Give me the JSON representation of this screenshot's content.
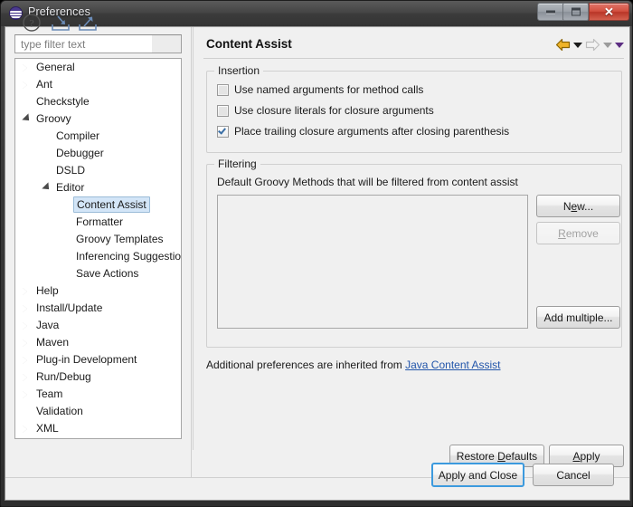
{
  "window": {
    "title": "Preferences",
    "icon": "eclipse-icon",
    "controls": {
      "minimize": "minimize-button",
      "maximize": "maximize-button",
      "close": "close-button"
    }
  },
  "sidebar": {
    "filter": {
      "placeholder": "type filter text",
      "value": ""
    },
    "items": [
      {
        "label": "General",
        "indent": 0,
        "state": "collapsed",
        "selected": false
      },
      {
        "label": "Ant",
        "indent": 0,
        "state": "collapsed",
        "selected": false
      },
      {
        "label": "Checkstyle",
        "indent": 0,
        "state": "leaf",
        "selected": false
      },
      {
        "label": "Groovy",
        "indent": 0,
        "state": "expanded",
        "selected": false
      },
      {
        "label": "Compiler",
        "indent": 1,
        "state": "leaf",
        "selected": false
      },
      {
        "label": "Debugger",
        "indent": 1,
        "state": "leaf",
        "selected": false
      },
      {
        "label": "DSLD",
        "indent": 1,
        "state": "leaf",
        "selected": false
      },
      {
        "label": "Editor",
        "indent": 1,
        "state": "expanded",
        "selected": false
      },
      {
        "label": "Content Assist",
        "indent": 2,
        "state": "leaf",
        "selected": true
      },
      {
        "label": "Formatter",
        "indent": 2,
        "state": "leaf",
        "selected": false
      },
      {
        "label": "Groovy Templates",
        "indent": 2,
        "state": "leaf",
        "selected": false
      },
      {
        "label": "Inferencing Suggestions",
        "indent": 2,
        "state": "leaf",
        "selected": false
      },
      {
        "label": "Save Actions",
        "indent": 2,
        "state": "leaf",
        "selected": false
      },
      {
        "label": "Help",
        "indent": 0,
        "state": "collapsed",
        "selected": false
      },
      {
        "label": "Install/Update",
        "indent": 0,
        "state": "collapsed",
        "selected": false
      },
      {
        "label": "Java",
        "indent": 0,
        "state": "collapsed",
        "selected": false
      },
      {
        "label": "Maven",
        "indent": 0,
        "state": "collapsed",
        "selected": false
      },
      {
        "label": "Plug-in Development",
        "indent": 0,
        "state": "collapsed",
        "selected": false
      },
      {
        "label": "Run/Debug",
        "indent": 0,
        "state": "collapsed",
        "selected": false
      },
      {
        "label": "Team",
        "indent": 0,
        "state": "collapsed",
        "selected": false
      },
      {
        "label": "Validation",
        "indent": 0,
        "state": "leaf",
        "selected": false
      },
      {
        "label": "XML",
        "indent": 0,
        "state": "collapsed",
        "selected": false
      }
    ]
  },
  "page": {
    "title": "Content Assist",
    "nav": {
      "back": "back-arrow-icon",
      "back_menu": "back-dropdown-icon",
      "forward": "forward-arrow-icon",
      "forward_menu": "forward-dropdown-icon",
      "view_menu": "view-menu-icon"
    },
    "insertion": {
      "legend": "Insertion",
      "options": [
        {
          "label": "Use named arguments for method calls",
          "checked": false
        },
        {
          "label": "Use closure literals for closure arguments",
          "checked": false
        },
        {
          "label": "Place trailing closure arguments after closing parenthesis",
          "checked": true
        }
      ]
    },
    "filtering": {
      "legend": "Filtering",
      "description": "Default Groovy Methods that will be filtered from content assist",
      "list_items": [],
      "buttons": [
        {
          "label": "New...",
          "mnemonic": "e",
          "enabled": true
        },
        {
          "label": "Remove",
          "mnemonic": "R",
          "enabled": false
        },
        {
          "label": "Add multiple...",
          "mnemonic": "",
          "enabled": true
        }
      ]
    },
    "inherit": {
      "text": "Additional preferences are inherited from ",
      "link": "Java Content Assist"
    },
    "page_buttons": [
      {
        "label": "Restore Defaults",
        "mnemonic": "D"
      },
      {
        "label": "Apply",
        "mnemonic": "A"
      }
    ]
  },
  "footer": {
    "icons": [
      {
        "name": "help-icon",
        "tooltip": "Help"
      },
      {
        "name": "import-icon",
        "tooltip": "Import"
      },
      {
        "name": "export-icon",
        "tooltip": "Export"
      }
    ],
    "apply_and_close": "Apply and Close",
    "cancel": "Cancel"
  },
  "colors": {
    "accent": "#3c9ade",
    "link": "#2255aa",
    "selection_bg": "#d3e5f7",
    "selection_border": "#9bbcd8",
    "checkmark": "#3a6ea5",
    "back_arrow": "#e8a317",
    "forward_arrow": "#c9c9c9",
    "view_menu": "#5c2d82",
    "close_button": "#c8412f",
    "dialog_bg": "#f0f0f0",
    "tree_bg": "#ffffff"
  }
}
